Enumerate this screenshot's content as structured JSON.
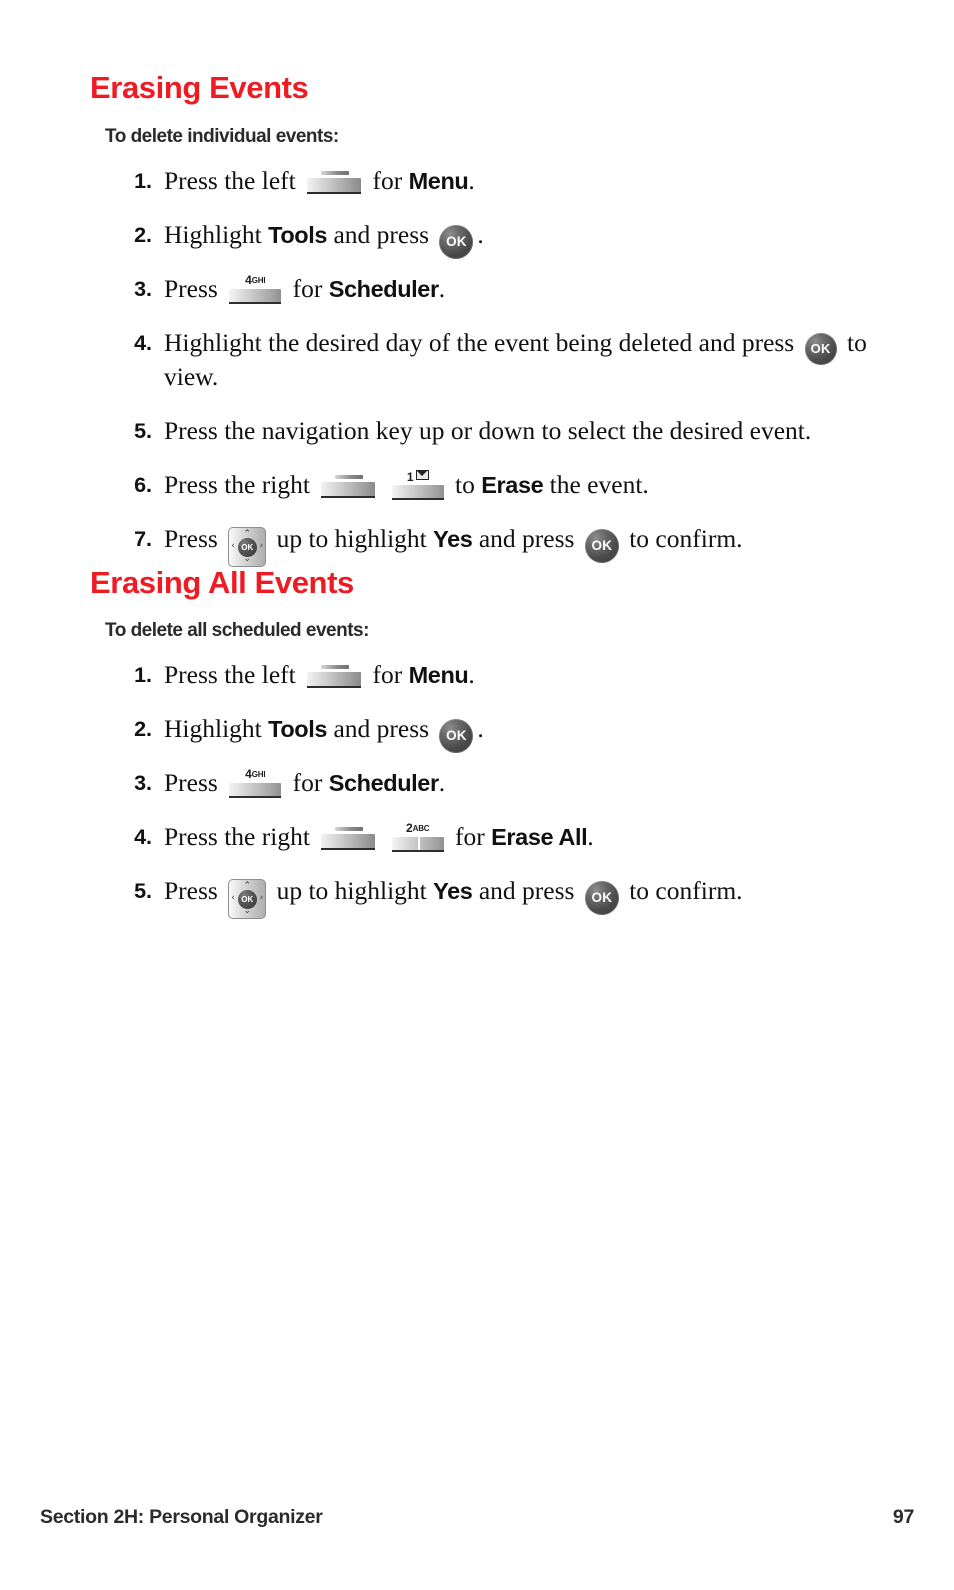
{
  "page": {
    "accent_color": "#ee1b22",
    "text_color": "#111111",
    "background": "#ffffff"
  },
  "sections": [
    {
      "heading": "Erasing Events",
      "subheading": "To delete individual events:",
      "steps": [
        {
          "num": "1.",
          "pre": "Press the left",
          "mid": "for",
          "bold": "Menu",
          "post": "."
        },
        {
          "num": "2.",
          "pre": "Highlight",
          "bold1": "Tools",
          "mid": "and press",
          "post": "."
        },
        {
          "num": "3.",
          "pre": "Press",
          "mid": "for",
          "bold": "Scheduler",
          "post": "."
        },
        {
          "num": "4.",
          "pre": "Highlight the desired day of the event being deleted and press",
          "post": "to view."
        },
        {
          "num": "5.",
          "pre": "Press the navigation key up or down to select the desired event."
        },
        {
          "num": "6.",
          "pre": "Press the right",
          "mid": "to",
          "bold": "Erase",
          "post": "the event."
        },
        {
          "num": "7.",
          "pre": "Press",
          "mid": "up to highlight",
          "bold": "Yes",
          "mid2": "and press",
          "post": "to confirm."
        }
      ]
    },
    {
      "heading": "Erasing All Events",
      "subheading": "To delete all scheduled events:",
      "steps": [
        {
          "num": "1.",
          "pre": "Press the left",
          "mid": "for",
          "bold": "Menu",
          "post": "."
        },
        {
          "num": "2.",
          "pre": "Highlight",
          "bold1": "Tools",
          "mid": "and press",
          "post": "."
        },
        {
          "num": "3.",
          "pre": "Press",
          "mid": "for",
          "bold": "Scheduler",
          "post": "."
        },
        {
          "num": "4.",
          "pre": "Press the right",
          "mid": "for",
          "bold": "Erase All",
          "post": "."
        },
        {
          "num": "5.",
          "pre": "Press",
          "mid": "up to highlight",
          "bold": "Yes",
          "mid2": "and press",
          "post": "to confirm."
        }
      ]
    }
  ],
  "keys": {
    "ok_label": "OK",
    "key4_digit": "4",
    "key4_letters": "GHI",
    "key2_digit": "2",
    "key2_letters": "ABC",
    "key1_digit": "1",
    "nav_up": "⌃",
    "nav_down": "⌄",
    "nav_left": "‹",
    "nav_right": "›"
  },
  "footer": {
    "left": "Section 2H: Personal Organizer",
    "right": "97"
  }
}
